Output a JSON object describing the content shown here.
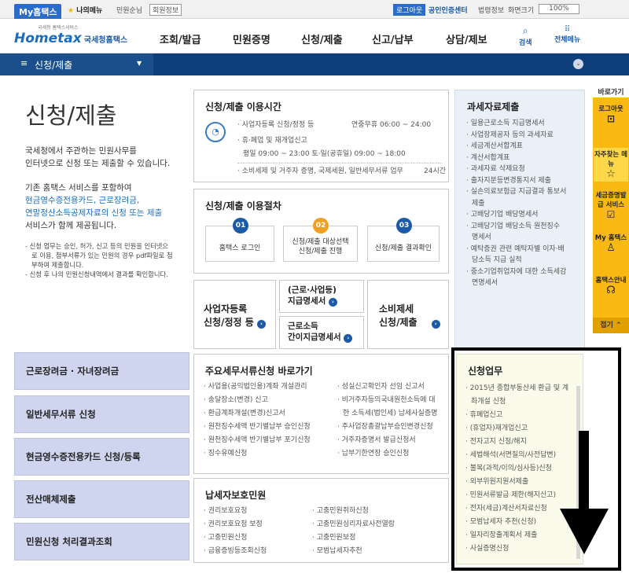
{
  "top": {
    "my": "My홈택스",
    "fav": "나의메뉴",
    "user": "민원순님",
    "info": "회원정보",
    "logout": "로그아웃",
    "cert": "공인인증센터",
    "law": "법령정보",
    "zoom_label": "화면크기",
    "zoom": "100%"
  },
  "logo": {
    "small": "국세청 홈택스서비스",
    "main": "Hometax",
    "sub": "국세청홈택스"
  },
  "menus": [
    "조회/발급",
    "민원증명",
    "신청/제출",
    "신고/납부",
    "상담/제보"
  ],
  "menu_search": "검색",
  "menu_all": "전체메뉴",
  "breadcrumb": "신청/제출",
  "intro": {
    "title": "신청/제출",
    "p1": "국세청에서 주관하는 민원사무를",
    "p1b": "인터넷으로 신청 또는 제출할 수 있습니다.",
    "p2a": "기존 홈택스 서비스를 포함하여",
    "p2b": "현금영수증전용카드, 근로장려금,",
    "p2c": "연말정산소득공제자료의 신청 또는 제출",
    "p2d": "서비스가 함께 제공됩니다.",
    "n1": "- 신청 업무는 승인, 허가, 신고 등의 민원을 인터넷으",
    "n1b": "로 이용, 첨부서류가 있는 민원의 경우 pdf파일로 첨",
    "n1c": "부하여 제출합니다.",
    "n2": "- 신청 후 나의 민원신청내역에서 결과를 확인합니다."
  },
  "hours": {
    "title": "신청/제출 이용시간",
    "r1": "· 사업자등록 신청/정정 등",
    "r1v": "연중무휴 06:00 ~ 24:00",
    "r2": "· 휴·폐업 및 재개업신고",
    "r3": "평일 09:00 ~ 23:00  토·일(공휴일) 09:00 ~ 18:00",
    "r4": "· 소비세제 및 거주자 증명, 국제세원, 일반세무서류 업무",
    "r4v": "24시간"
  },
  "proc": {
    "title": "신청/제출 이용절차",
    "s1n": "01",
    "s1": "홈택스 로그인",
    "s2n": "02",
    "s2a": "신청/제출 대상선택",
    "s2b": "신청/제출 진행",
    "s3n": "03",
    "s3": "신청/제출 결과확인"
  },
  "tiles": {
    "a1": "사업자등록",
    "a2": "신청/정정 등",
    "b1": "(근로·사업등)",
    "b2": "지급명세서",
    "c1": "근로소득",
    "c2": "간이지급명세서",
    "d1": "소비제세",
    "d2": "신청/제출"
  },
  "left_buttons": [
    "근로장려금 · 자녀장려금",
    "일반세무서류 신청",
    "현금영수증전용카드 신청/등록",
    "전산매체제출",
    "민원신청 처리결과조회"
  ],
  "major": {
    "title": "주요세무서류신청 바로가기",
    "col1": [
      "사업용(공익법인용)계좌 개설관리",
      "송달장소(변경) 신고",
      "환급계좌개설(변경)신고서",
      "원천징수세액 반기별납부 승인신청",
      "원천징수세액 반기별납부 포기신청",
      "징수유예신청"
    ],
    "col2": [
      "성실신고확인자 선임 신고서",
      "비거주자등의국내원천소득에 대",
      "한 소득세(법인세) 납세사실증명",
      "주사업장총괄납부승인변경신청",
      "거주자증명서 발급신청서",
      "납부기한연장 승인신청"
    ]
  },
  "protect": {
    "title": "납세자보호민원",
    "col1": [
      "권리보호요청",
      "권리보호요청 보정",
      "고충민원신청",
      "금융증빙등조회신청"
    ],
    "col2": [
      "고충민원취하신청",
      "고충민원심리자료사전열람",
      "고충민원보정",
      "모범납세자추천"
    ]
  },
  "tax": {
    "title": "과세자료제출",
    "items": [
      "일용근로소득 지급명세서",
      "사업장제공자 등의 과세자료",
      "세금계산서합계표",
      "계산서합계표",
      "과세자료 삭제요청",
      "출자지분등변경통지서 제출",
      "실손의료보험금 지급결과 통보서",
      "제출",
      "고배당기업 배당명세서",
      "고배당기업 배당소득 원천징수",
      "명세서",
      "예탁증권 관련 예탁자별 이자·배",
      "당소득 지급 실적",
      "중소기업취업자에 대한 소득세감",
      "면명세서"
    ]
  },
  "apply": {
    "title": "신청업무",
    "items": [
      "2015년 종합부동산세 환급 및 계",
      "좌개설 신청",
      "휴폐업신고",
      "(휴업자)재개업신고",
      "전자고지 신청/해지",
      "세법해석(서면질의/사전답변)",
      "불복(과적/이의/심사등)신청",
      "외부위원지원서제출",
      "민원서류발급 제한(해지신고)",
      "전자(세금)계산서자료신청",
      "모범납세자 추천(신청)",
      "일자리창출계획서 제출",
      "사실증명신청"
    ]
  },
  "quick": {
    "title": "바로가기",
    "items": [
      "로그아웃",
      "자주찾는 메뉴",
      "세금증명발급 서비스",
      "My 홈택스",
      "홈택스안내"
    ],
    "close": "접기"
  }
}
